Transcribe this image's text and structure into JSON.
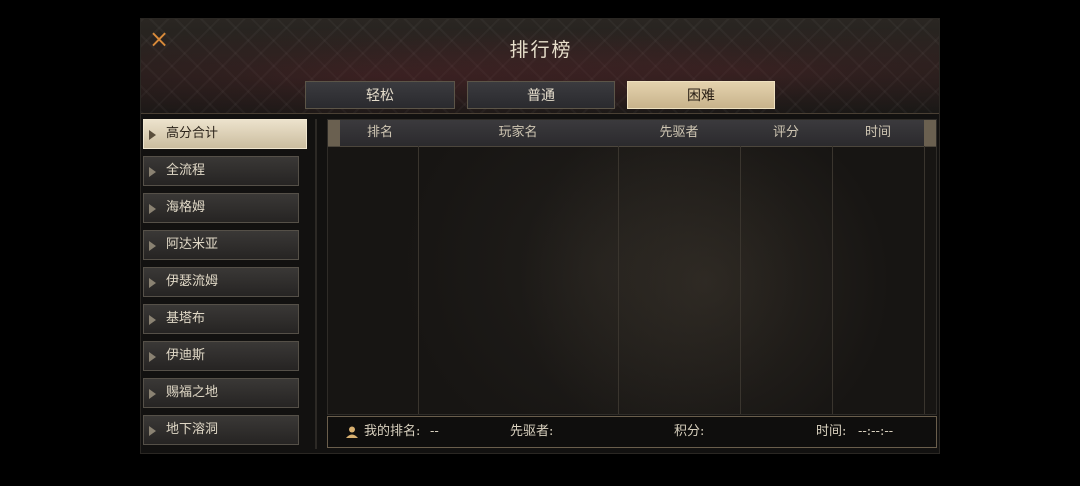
{
  "window": {
    "title": "排行榜",
    "close_icon": "×"
  },
  "tabs": [
    {
      "label": "轻松",
      "active": false
    },
    {
      "label": "普通",
      "active": false
    },
    {
      "label": "困难",
      "active": true
    }
  ],
  "sidebar": {
    "items": [
      {
        "label": "高分合计",
        "active": true
      },
      {
        "label": "全流程"
      },
      {
        "label": "海格姆"
      },
      {
        "label": "阿达米亚"
      },
      {
        "label": "伊瑟流姆"
      },
      {
        "label": "基塔布"
      },
      {
        "label": "伊迪斯"
      },
      {
        "label": "赐福之地"
      },
      {
        "label": "地下溶洞"
      }
    ]
  },
  "table": {
    "columns": [
      "排名",
      "玩家名",
      "先驱者",
      "评分",
      "时间"
    ]
  },
  "footer": {
    "my_rank_label": "我的排名:",
    "my_rank_value": "--",
    "pioneer_label": "先驱者:",
    "pioneer_value": "",
    "score_label": "积分:",
    "score_value": "",
    "time_label": "时间:",
    "time_value": "--:--:--"
  },
  "colors": {
    "accent": "#d88a3a",
    "active_tab": "#d8c49e",
    "panel": "#121110"
  }
}
